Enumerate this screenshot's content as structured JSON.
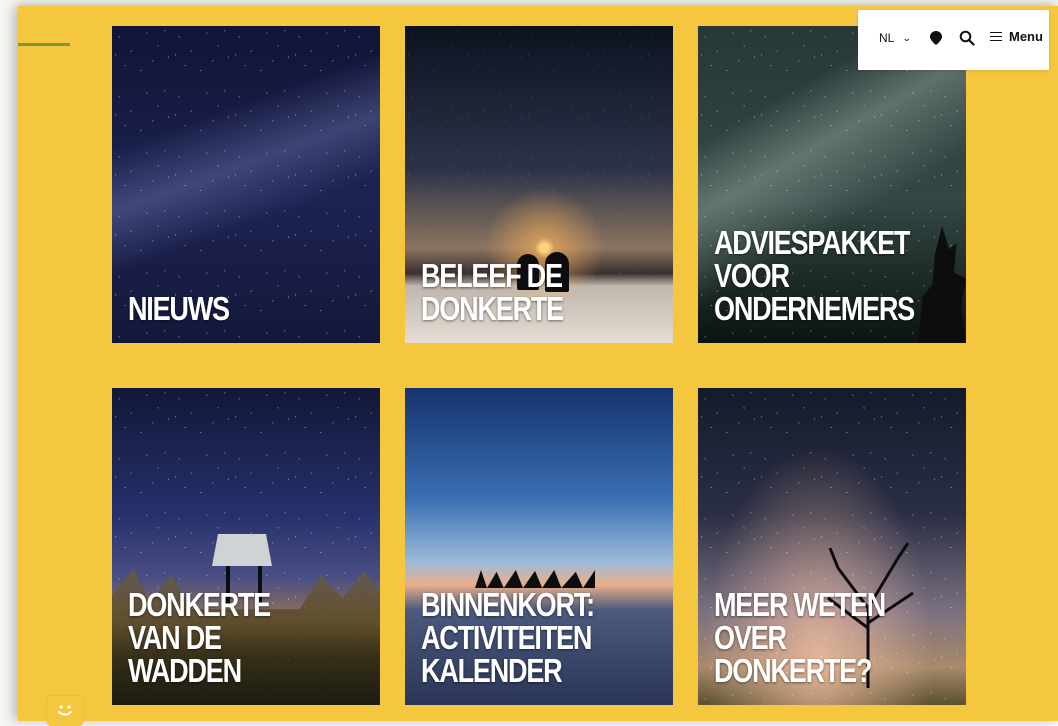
{
  "header": {
    "language": "NL",
    "language_chevron": "chevron-down-icon",
    "location_icon": "map-pin-icon",
    "search_icon": "search-icon",
    "menu_label": "Menu",
    "menu_icon": "hamburger-icon"
  },
  "tiles": [
    {
      "label": "NIEUWS"
    },
    {
      "label": "BELEEF DE DONKERTE"
    },
    {
      "label": "ADVIESPAKKET VOOR\nONDERNEMERS"
    },
    {
      "label": "DONKERTE VAN DE\nWADDEN"
    },
    {
      "label": "BINNENKORT:\nACTIVITEITEN\nKALENDER"
    },
    {
      "label": "MEER WETEN OVER\nDONKERTE?"
    }
  ],
  "colors": {
    "background": "#f4c73f",
    "accent": "#7a9a3a",
    "text_on_image": "#ffffff"
  },
  "feedback_widget": {
    "icon": "smiley-icon"
  }
}
